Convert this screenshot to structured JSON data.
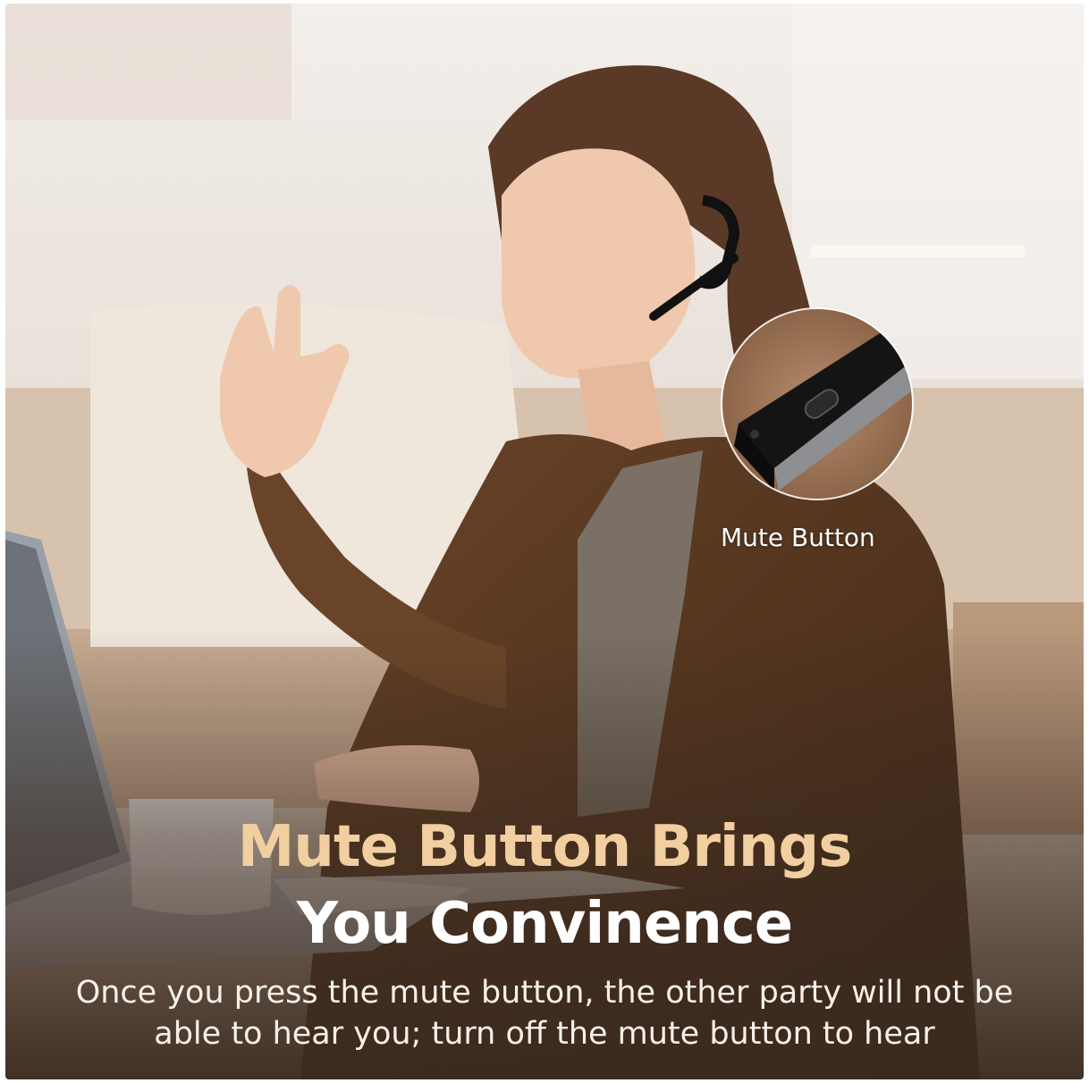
{
  "callout": {
    "label": "Mute Button"
  },
  "headline": {
    "line1": "Mute Button Brings",
    "line2": "You Convinence"
  },
  "body": {
    "line1": "Once you press the mute button, the other party will not be",
    "line2": "able to hear you; turn off the mute button to hear"
  },
  "colors": {
    "headline_line1": "#f2cfa0",
    "headline_line2": "#ffffff",
    "body_text": "#f6f0ea",
    "callout_text": "#ffffff"
  }
}
